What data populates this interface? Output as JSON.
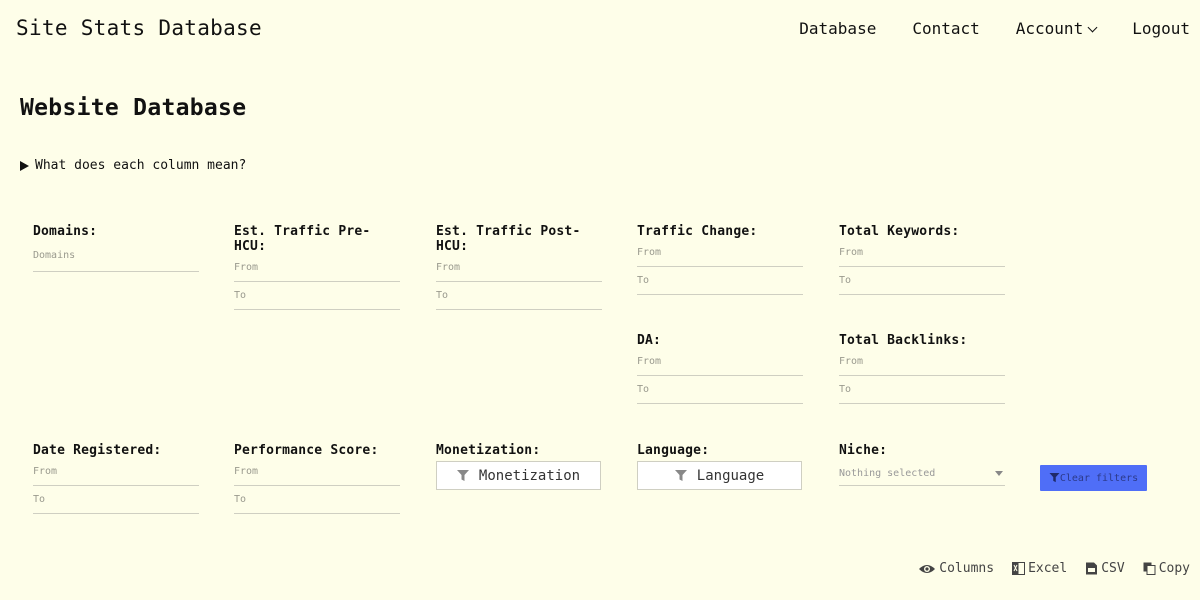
{
  "nav": {
    "brand": "Site Stats Database",
    "links": {
      "database": "Database",
      "contact": "Contact",
      "account": "Account",
      "logout": "Logout"
    }
  },
  "page": {
    "title": "Website Database",
    "details_summary": "What does each column mean?"
  },
  "filters": {
    "domains": {
      "label": "Domains:",
      "placeholder": "Domains"
    },
    "traffic_pre": {
      "label": "Est. Traffic Pre-HCU:",
      "from": "From",
      "to": "To"
    },
    "traffic_post": {
      "label": "Est. Traffic Post-HCU:",
      "from": "From",
      "to": "To"
    },
    "traffic_change": {
      "label": "Traffic Change:",
      "from": "From",
      "to": "To"
    },
    "total_keywords": {
      "label": "Total Keywords:",
      "from": "From",
      "to": "To"
    },
    "da": {
      "label": "DA:",
      "from": "From",
      "to": "To"
    },
    "total_backlinks": {
      "label": "Total Backlinks:",
      "from": "From",
      "to": "To"
    },
    "date_registered": {
      "label": "Date Registered:",
      "from": "From",
      "to": "To"
    },
    "performance_score": {
      "label": "Performance Score:",
      "from": "From",
      "to": "To"
    },
    "monetization": {
      "label": "Monetization:",
      "button": "Monetization"
    },
    "language": {
      "label": "Language:",
      "button": "Language"
    },
    "niche": {
      "label": "Niche:",
      "selected": "Nothing selected"
    },
    "clear": "Clear filters"
  },
  "tools": {
    "columns": "Columns",
    "excel": "Excel",
    "csv": "CSV",
    "copy": "Copy"
  },
  "colors": {
    "background": "#fefee9",
    "accent": "#4f6ef7"
  }
}
